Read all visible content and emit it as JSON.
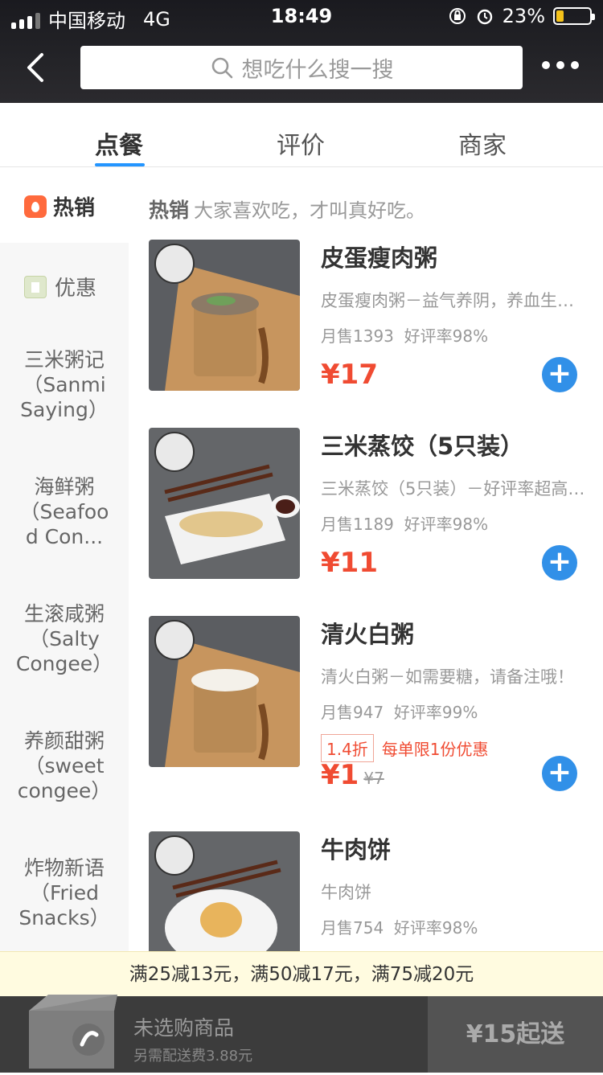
{
  "status_bar": {
    "carrier": "中国移动",
    "network": "4G",
    "time": "18:49",
    "battery_percent": "23%",
    "battery_level": 0.23
  },
  "header": {
    "search_placeholder": "想吃什么搜一搜"
  },
  "tabs": [
    "点餐",
    "评价",
    "商家"
  ],
  "sidebar": {
    "items": [
      {
        "label": "热销"
      },
      {
        "label": "优惠"
      },
      {
        "label": "三米粥记\n（Sanmi\nSaying）"
      },
      {
        "label": "海鲜粥\n（Seafoo\nd Con..."
      },
      {
        "label": "生滚咸粥\n（Salty\nCongee）"
      },
      {
        "label": "养颜甜粥\n（sweet\ncongee）"
      },
      {
        "label": "炸物新语\n（Fried\nSnacks）"
      }
    ]
  },
  "section": {
    "title": "热销",
    "subtitle": "大家喜欢吃，才叫真好吃。"
  },
  "products": [
    {
      "name": "皮蛋瘦肉粥",
      "desc": "皮蛋瘦肉粥－益气养阴，养血生津…",
      "monthly_sales": "月售1393",
      "rating": "好评率98%",
      "price": "¥17"
    },
    {
      "name": "三米蒸饺（5只装）",
      "desc": "三米蒸饺（5只装）－好评率超高…",
      "monthly_sales": "月售1189",
      "rating": "好评率98%",
      "price": "¥11"
    },
    {
      "name": "清火白粥",
      "desc": "清火白粥－如需要糖，请备注哦！",
      "monthly_sales": "月售947",
      "rating": "好评率99%",
      "discount": "1.4折",
      "limit": "每单限1份优惠",
      "price": "¥1",
      "original_price": "¥7"
    },
    {
      "name": "牛肉饼",
      "desc": "牛肉饼",
      "monthly_sales": "月售754",
      "rating": "好评率98%"
    }
  ],
  "promo_bar": "满25减13元，满50减17元，满75减20元",
  "cart": {
    "empty_text": "未选购商品",
    "delivery_fee": "另需配送费3.88元",
    "min_order": "¥15起送"
  }
}
